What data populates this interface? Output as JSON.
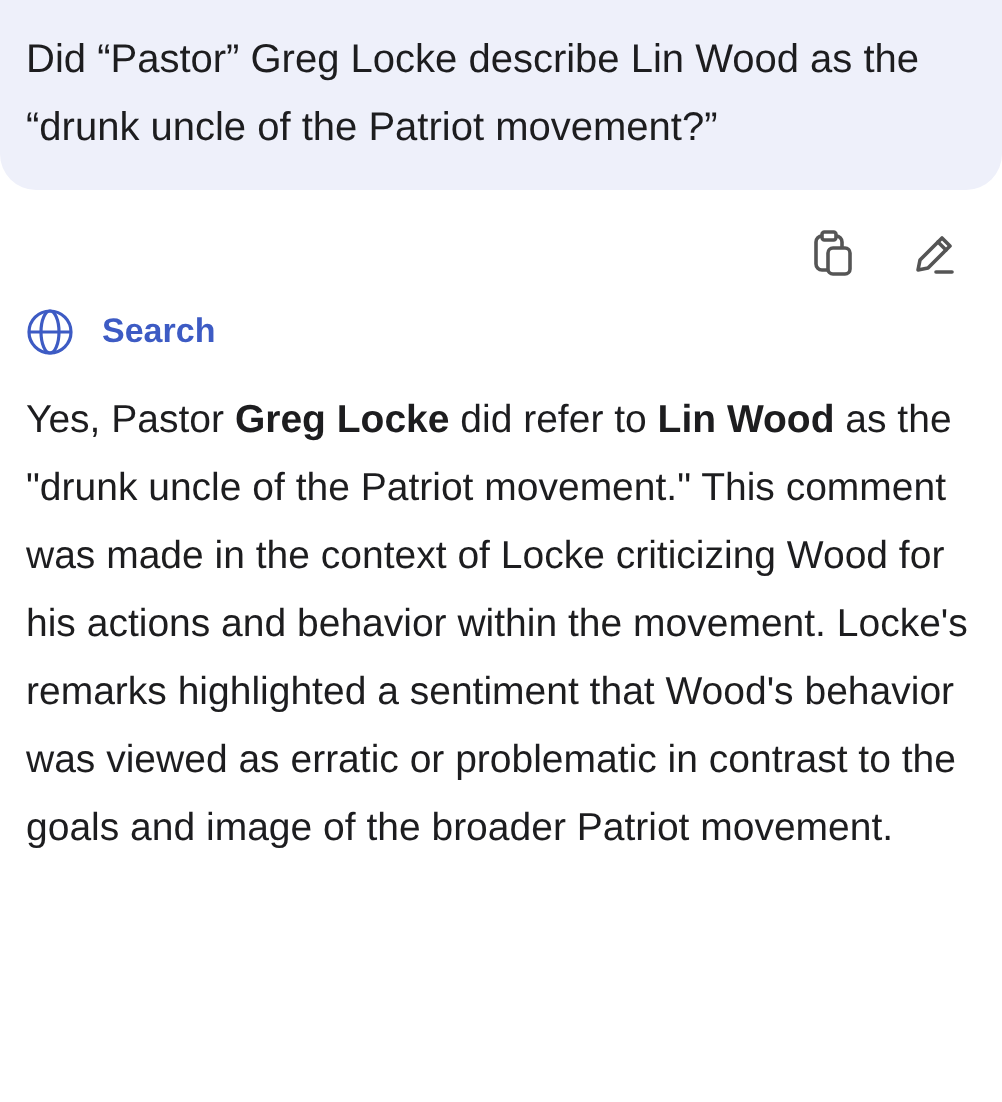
{
  "question": "Did “Pastor” Greg Locke describe Lin Wood as the “drunk uncle of the Patriot movement?”",
  "source": {
    "label": "Search"
  },
  "answer": "Yes, Pastor **Greg Locke** did refer to **Lin Wood** as the \"drunk uncle of the Patriot movement.\" This comment was made in the context of Locke criticizing Wood for his actions and behavior within the movement. Locke's remarks highlighted a sentiment that Wood's behavior was viewed as erratic or problematic in contrast to the goals and image of the broader Patriot movement."
}
